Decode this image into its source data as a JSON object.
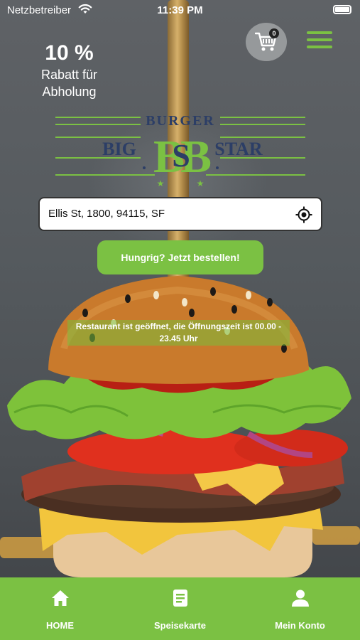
{
  "status_bar": {
    "carrier": "Netzbetreiber",
    "time": "11:39 PM"
  },
  "header": {
    "discount_percent": "10 %",
    "discount_line1": "Rabatt für",
    "discount_line2": "Abholung",
    "cart_count": "0"
  },
  "logo": {
    "word_top": "BURGER",
    "word_left": "BIG",
    "word_right": "STAR",
    "monogram": "BB",
    "monogram_center": "S"
  },
  "address": {
    "value": "Ellis St, 1800, 94115, SF"
  },
  "order_button": {
    "label": "Hungrig? Jetzt bestellen!"
  },
  "restaurant_status": {
    "line1": "Restaurant ist geöffnet, die Öffnungszeit ist 00.00 -",
    "line2": "23.45 Uhr"
  },
  "tabs": [
    {
      "label": "HOME",
      "icon": "home-icon"
    },
    {
      "label": "Speisekarte",
      "icon": "menu-card-icon"
    },
    {
      "label": "Mein Konto",
      "icon": "user-icon"
    }
  ],
  "colors": {
    "accent": "#7bc143",
    "logo_navy": "#2c3e66"
  }
}
